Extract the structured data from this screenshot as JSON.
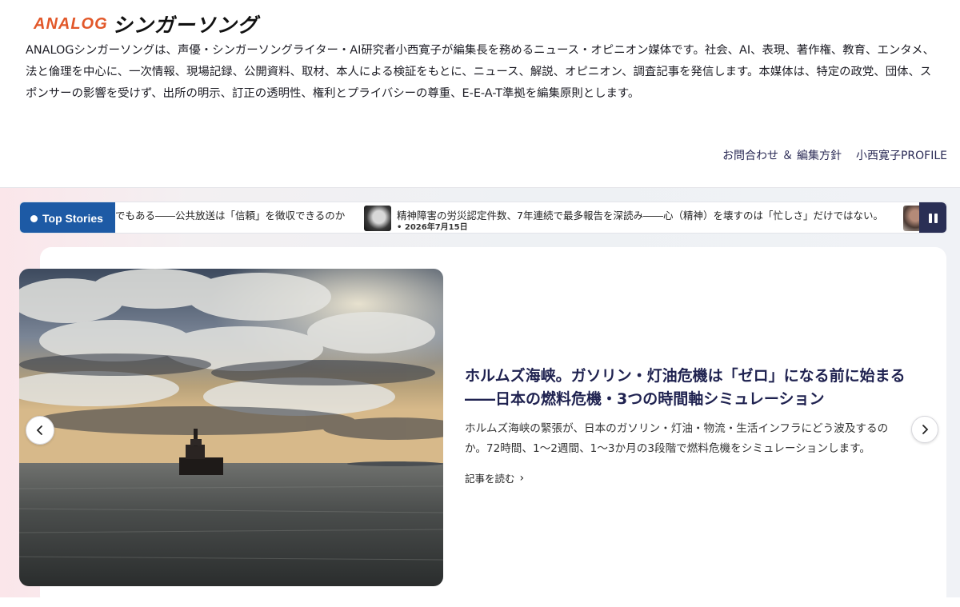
{
  "header": {
    "logo_text_latin": "ANALOG",
    "logo_text_jp": "シンガーソング",
    "description": "ANALOGシンガーソングは、声優・シンガーソングライター・AI研究者小西寛子が編集長を務めるニュース・オピニオン媒体です。社会、AI、表現、著作権、教育、エンタメ、法と倫理を中心に、一次情報、現場記録、公開資料、取材、本人による検証をもとに、ニュース、解説、オピニオン、調査記事を発信します。本媒体は、特定の政党、団体、スポンサーの影響を受けず、出所の明示、訂正の透明性、権利とプライバシーの尊重、E-E-A-T準拠を編集原則とします。",
    "nav": [
      {
        "label": "お問合わせ ＆ 編集方針"
      },
      {
        "label": "小西寛子PROFILE"
      }
    ]
  },
  "ticker": {
    "label": "Top Stories",
    "items": [
      {
        "title": "でもある――公共放送は「信頼」を徴収できるのか"
      },
      {
        "title": "精神障害の労災認定件数、7年連続で最多報告を深読み――心（精神）を壊すのは「忙しさ」だけではない。",
        "date": "• 2026年7月15日"
      }
    ],
    "pause_icon": "pause-icon"
  },
  "hero": {
    "title": "ホルムズ海峡。ガソリン・灯油危機は「ゼロ」になる前に始まる――日本の燃料危機・3つの時間軸シミュレーション",
    "summary": "ホルムズ海峡の緊張が、日本のガソリン・灯油・物流・生活インフラにどう波及するのか。72時間、1〜2週間、1〜3か月の3段階で燃料危機をシミュレーションします。",
    "read_more": "記事を読む",
    "read_more_icon": "chevron-right-icon",
    "prev_icon": "chevron-left-icon",
    "next_icon": "chevron-right-icon"
  },
  "colors": {
    "ticker_label_bg": "#1d5aa5",
    "pause_bg": "#2a2f55",
    "title_color": "#1f2250",
    "logo_accent": "#e2582a"
  }
}
